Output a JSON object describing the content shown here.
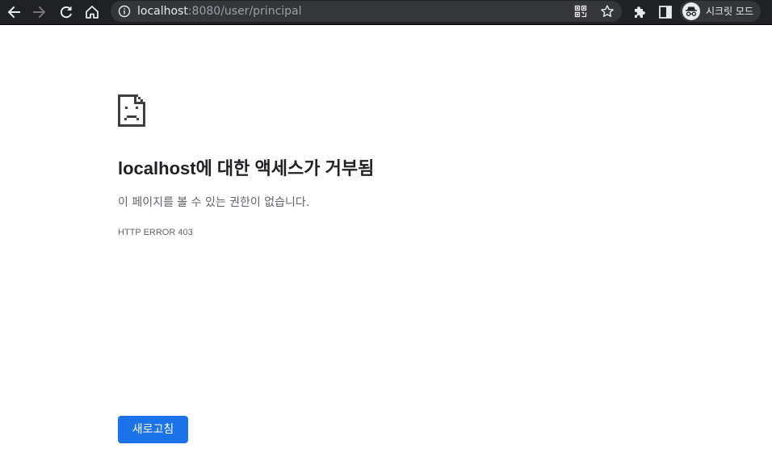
{
  "toolbar": {
    "icons": {
      "back": "arrow-left-icon",
      "forward": "arrow-right-icon",
      "reload": "reload-icon",
      "home": "home-icon",
      "info": "info-icon",
      "qr": "qr-code-icon",
      "bookmark": "star-icon",
      "extensions": "puzzle-icon",
      "side_panel": "side-panel-icon",
      "profile": "incognito-icon"
    },
    "url_host": "localhost",
    "url_rest": ":8080/user/principal",
    "profile_label": "시크릿 모드",
    "colors": {
      "toolbar_bg": "#202124",
      "omnibox_bg": "#35363a",
      "icon_active": "#e8eaed",
      "icon_disabled": "#757575"
    }
  },
  "page": {
    "icon": "sad-page-icon",
    "heading_host": "localhost",
    "heading_rest": "에 대한 액세스가 거부됨",
    "subtext": "이 페이지를 볼 수 있는 권한이 없습니다.",
    "error_code": "HTTP ERROR 403",
    "reload_label": "새로고침",
    "colors": {
      "button_bg": "#1a73e8",
      "heading": "#202124",
      "secondary": "#5f6368"
    }
  }
}
